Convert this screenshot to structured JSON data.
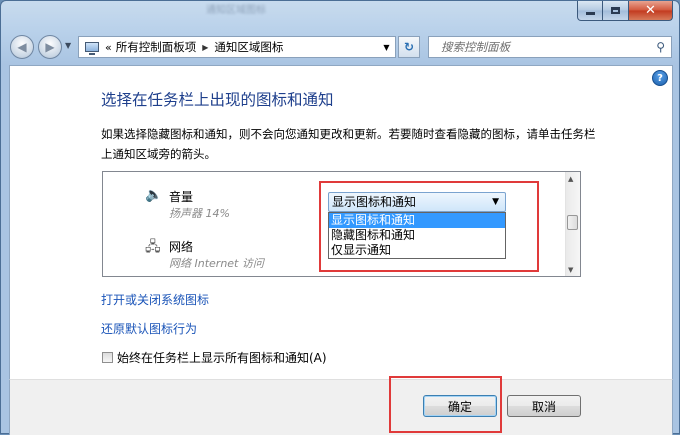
{
  "window": {
    "background_caption": "通知区域图标"
  },
  "nav": {
    "back_icon": "back-arrow-icon",
    "forward_icon": "forward-arrow-icon"
  },
  "address": {
    "chevron": "«",
    "crumbs": [
      "所有控制面板项",
      "通知区域图标"
    ]
  },
  "search": {
    "placeholder": "搜索控制面板"
  },
  "page": {
    "title": "选择在任务栏上出现的图标和通知",
    "description": "如果选择隐藏图标和通知，则不会向您通知更改和更新。若要随时查看隐藏的图标，请单击任务栏上通知区域旁的箭头。"
  },
  "list": {
    "items": [
      {
        "name": "音量",
        "subtitle": "扬声器 14%",
        "icon": "speaker-icon"
      },
      {
        "name": "网络",
        "subtitle": "网络 Internet 访问",
        "icon": "network-icon"
      }
    ],
    "dropdown": {
      "selected": "显示图标和通知",
      "options": [
        "显示图标和通知",
        "隐藏图标和通知",
        "仅显示通知"
      ]
    }
  },
  "links": {
    "system_icons": "打开或关闭系统图标",
    "restore": "还原默认图标行为"
  },
  "checkbox": {
    "label": "始终在任务栏上显示所有图标和通知(A)",
    "checked": false
  },
  "buttons": {
    "ok": "确定",
    "cancel": "取消"
  },
  "colors": {
    "annotation_red": "#e03a3a",
    "link_blue": "#1a54b8",
    "title_blue": "#1e3f8c",
    "selection_blue": "#3399ff"
  }
}
